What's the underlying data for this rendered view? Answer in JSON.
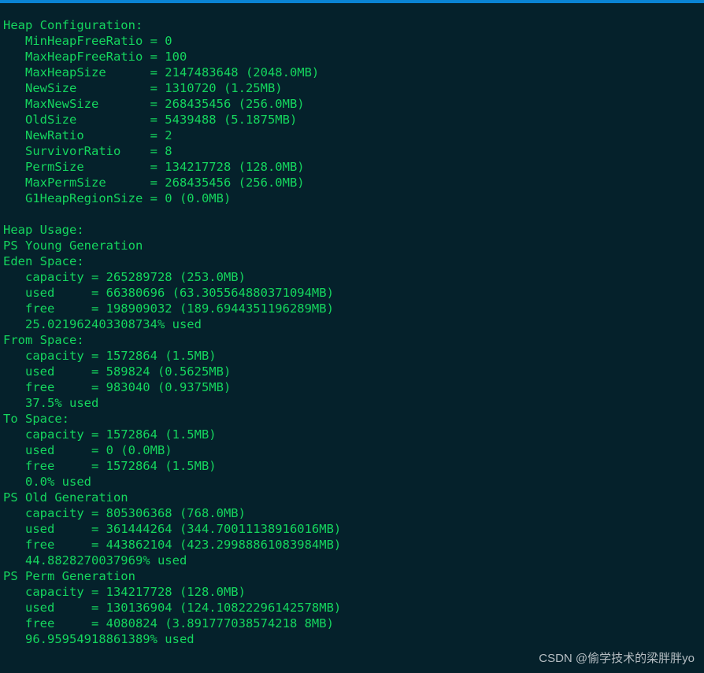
{
  "window": {
    "accent_color": "#0a84d4",
    "background_color": "#05212b",
    "text_color": "#15d65e"
  },
  "terminal": {
    "lines": [
      "Heap Configuration:",
      "   MinHeapFreeRatio = 0",
      "   MaxHeapFreeRatio = 100",
      "   MaxHeapSize      = 2147483648 (2048.0MB)",
      "   NewSize          = 1310720 (1.25MB)",
      "   MaxNewSize       = 268435456 (256.0MB)",
      "   OldSize          = 5439488 (5.1875MB)",
      "   NewRatio         = 2",
      "   SurvivorRatio    = 8",
      "   PermSize         = 134217728 (128.0MB)",
      "   MaxPermSize      = 268435456 (256.0MB)",
      "   G1HeapRegionSize = 0 (0.0MB)",
      "",
      "Heap Usage:",
      "PS Young Generation",
      "Eden Space:",
      "   capacity = 265289728 (253.0MB)",
      "   used     = 66380696 (63.305564880371094MB)",
      "   free     = 198909032 (189.6944351196289MB)",
      "   25.021962403308734% used",
      "From Space:",
      "   capacity = 1572864 (1.5MB)",
      "   used     = 589824 (0.5625MB)",
      "   free     = 983040 (0.9375MB)",
      "   37.5% used",
      "To Space:",
      "   capacity = 1572864 (1.5MB)",
      "   used     = 0 (0.0MB)",
      "   free     = 1572864 (1.5MB)",
      "   0.0% used",
      "PS Old Generation",
      "   capacity = 805306368 (768.0MB)",
      "   used     = 361444264 (344.70011138916016MB)",
      "   free     = 443862104 (423.29988861083984MB)",
      "   44.8828270037969% used",
      "PS Perm Generation",
      "   capacity = 134217728 (128.0MB)",
      "   used     = 130136904 (124.10822296142578MB)",
      "   free     = 4080824 (3.891777038574218 8MB)",
      "   96.95954918861389% used"
    ]
  },
  "watermark": {
    "text": "CSDN @偷学技术的梁胖胖yo"
  }
}
